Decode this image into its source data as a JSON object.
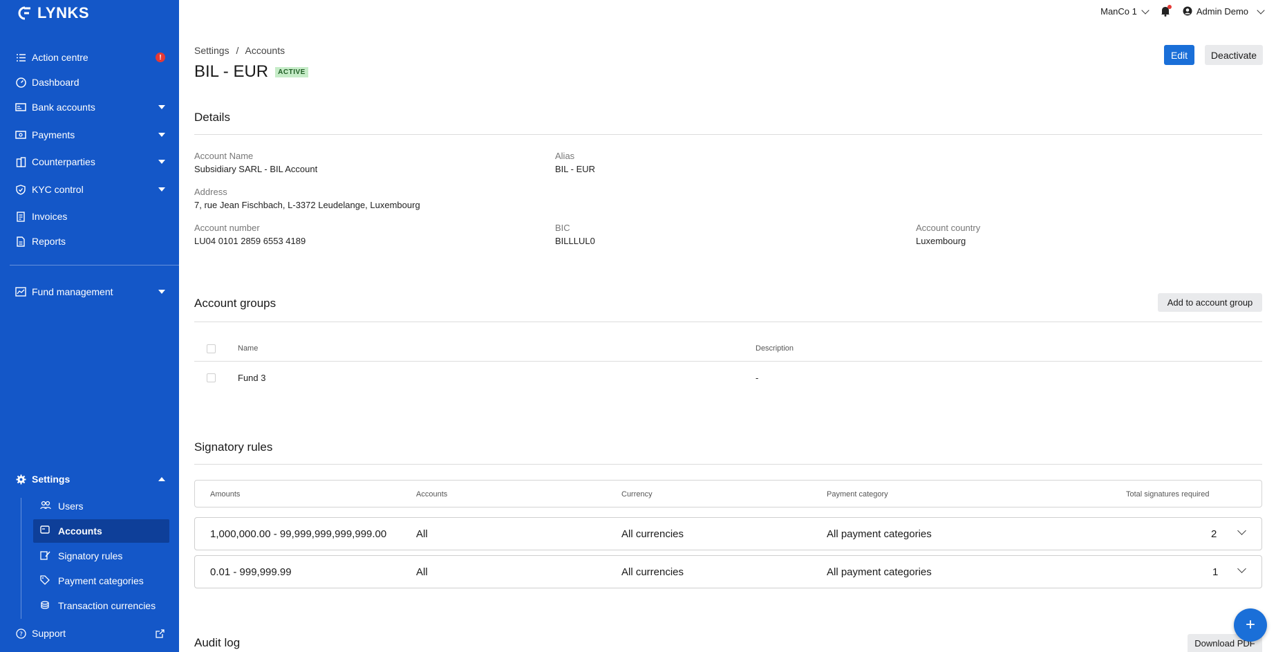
{
  "app": {
    "logo_text": "LYNKS"
  },
  "sidebar": {
    "items": [
      {
        "label": "Action centre",
        "icon": "list-check-icon",
        "alert": "!"
      },
      {
        "label": "Dashboard",
        "icon": "gauge-icon"
      },
      {
        "label": "Bank accounts",
        "icon": "bank-card-icon"
      },
      {
        "label": "Payments",
        "icon": "payment-icon"
      },
      {
        "label": "Counterparties",
        "icon": "building-icon"
      },
      {
        "label": "KYC control",
        "icon": "shield-check-icon"
      },
      {
        "label": "Invoices",
        "icon": "invoice-icon"
      },
      {
        "label": "Reports",
        "icon": "report-icon"
      },
      {
        "label": "Fund management",
        "icon": "chart-icon"
      }
    ],
    "settings": {
      "label": "Settings",
      "sub_items": [
        {
          "label": "Users",
          "icon": "users-icon"
        },
        {
          "label": "Accounts",
          "icon": "account-card-icon",
          "active": true
        },
        {
          "label": "Signatory rules",
          "icon": "signature-icon"
        },
        {
          "label": "Payment categories",
          "icon": "tag-icon"
        },
        {
          "label": "Transaction currencies",
          "icon": "coins-icon"
        }
      ]
    },
    "support": {
      "label": "Support"
    }
  },
  "topbar": {
    "entity": "ManCo 1",
    "user": "Admin Demo"
  },
  "breadcrumb": {
    "parent": "Settings",
    "separator": "/",
    "current": "Accounts"
  },
  "page": {
    "title": "BIL - EUR",
    "status": "ACTIVE",
    "edit_label": "Edit",
    "deactivate_label": "Deactivate"
  },
  "details": {
    "title": "Details",
    "account_name_label": "Account Name",
    "account_name": "Subsidiary SARL - BIL Account",
    "alias_label": "Alias",
    "alias": "BIL - EUR",
    "address_label": "Address",
    "address": "7, rue Jean Fischbach, L-3372 Leudelange, Luxembourg",
    "account_number_label": "Account number",
    "account_number": "LU04 0101 2859 6553 4189",
    "bic_label": "BIC",
    "bic": "BILLLUL0",
    "country_label": "Account country",
    "country": "Luxembourg"
  },
  "account_groups": {
    "title": "Account groups",
    "add_label": "Add to account group",
    "columns": [
      "Name",
      "Description"
    ],
    "rows": [
      {
        "name": "Fund 3",
        "description": "-"
      }
    ]
  },
  "signatory_rules": {
    "title": "Signatory rules",
    "columns": [
      "Amounts",
      "Accounts",
      "Currency",
      "Payment category",
      "Total signatures required"
    ],
    "rows": [
      {
        "amounts": "1,000,000.00 - 99,999,999,999,999.00",
        "accounts": "All",
        "currency": "All currencies",
        "category": "All payment categories",
        "signatures": "2"
      },
      {
        "amounts": "0.01 - 999,999.99",
        "accounts": "All",
        "currency": "All currencies",
        "category": "All payment categories",
        "signatures": "1"
      }
    ]
  },
  "audit_log": {
    "title": "Audit log",
    "download_label": "Download PDF"
  },
  "fab": {
    "label": "+"
  }
}
